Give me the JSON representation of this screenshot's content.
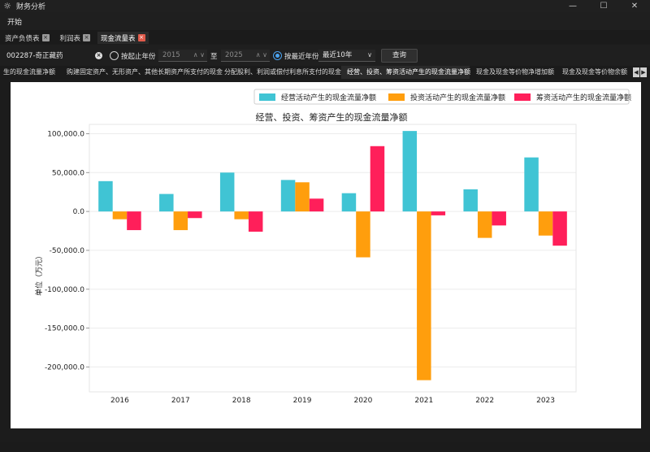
{
  "window": {
    "title": "财务分析",
    "minimize": "—",
    "maximize": "☐",
    "close": "✕"
  },
  "menu": {
    "start": "开始"
  },
  "tabs": [
    {
      "label": "资产负债表",
      "close": "×"
    },
    {
      "label": "利润表",
      "close": "×"
    },
    {
      "label": "现金流量表",
      "close": "×"
    }
  ],
  "query": {
    "stock": "002287-奇正藏药",
    "by_start_end": "按起止年份",
    "start_year": "2015",
    "to": "至",
    "end_year": "2025",
    "by_recent": "按最近年份",
    "recent_option": "最近10年",
    "search_button": "查询"
  },
  "chart_tabs": [
    "生的现金流量净额",
    "购建固定资产、无形资产、其他长期资产所支付的现金",
    "分配股利、利润或偿付利息所支付的现金",
    "经营、投资、筹资活动产生的现金流量净额",
    "现金及现金等价物净增加额",
    "现金及现金等价物余额"
  ],
  "colors": {
    "operating": "#40c4d4",
    "investing": "#ff9e0d",
    "financing": "#ff1f5a"
  },
  "chart_data": {
    "type": "bar",
    "title": "经营、投资、筹资产生的现金流量净额",
    "ylabel": "单位（万元）",
    "xlabel": "",
    "categories": [
      "2016",
      "2017",
      "2018",
      "2019",
      "2020",
      "2021",
      "2022",
      "2023"
    ],
    "series": [
      {
        "name": "经营活动产生的现金流量净额",
        "values": [
          39000,
          22500,
          50000,
          40500,
          23500,
          103500,
          28500,
          69500
        ]
      },
      {
        "name": "投资活动产生的现金流量净额",
        "values": [
          -10000,
          -24000,
          -10000,
          37500,
          -59000,
          -217000,
          -34000,
          -31000
        ]
      },
      {
        "name": "筹资活动产生的现金流量净额",
        "values": [
          -24000,
          -8500,
          -26000,
          16500,
          84000,
          -5000,
          -18000,
          -44000
        ]
      }
    ],
    "ylim": [
      -232000,
      112000
    ],
    "yticks": [
      100000,
      50000,
      0,
      -50000,
      -100000,
      -150000,
      -200000
    ],
    "ytick_labels": [
      "100,000.0",
      "50,000.0",
      "0.0",
      "-50,000.0",
      "-100,000.0",
      "-150,000.0",
      "-200,000.0"
    ],
    "legend": "top-right",
    "grid": true
  }
}
